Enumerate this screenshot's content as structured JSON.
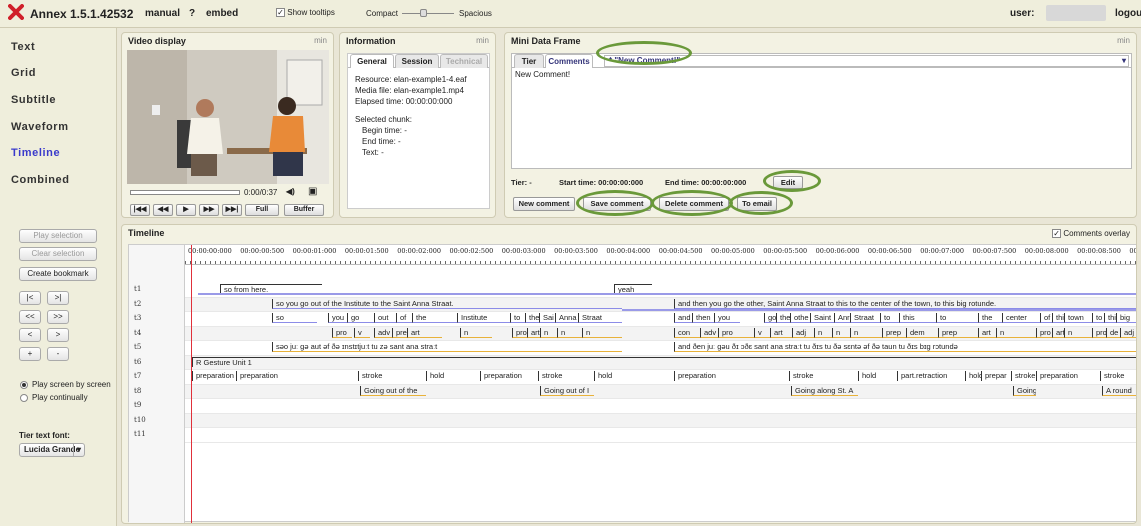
{
  "app": {
    "name": "Annex 1.5.1.42532",
    "manual": "manual",
    "help": "?",
    "embed": "embed",
    "tooltips": "Show tooltips",
    "compact": "Compact",
    "spacious": "Spacious",
    "user_label": "user:",
    "logout": "logout"
  },
  "nav": {
    "items": [
      "Text",
      "Grid",
      "Subtitle",
      "Waveform",
      "Timeline",
      "Combined"
    ],
    "active": "Timeline"
  },
  "side": {
    "play_selection": "Play selection",
    "clear_selection": "Clear selection",
    "create_bookmark": "Create bookmark",
    "b1": "|<",
    "b2": ">|",
    "b3": "<<",
    "b4": ">>",
    "b5": "<",
    "b6": ">",
    "b7": "+",
    "b8": "-",
    "radio1": "Play screen by screen",
    "radio2": "Play continually",
    "font_label": "Tier text font:",
    "font_value": "Lucida Grande"
  },
  "video": {
    "title": "Video display",
    "min": "min",
    "time": "0:00/0:37",
    "vol": "◀)",
    "fs": "▣",
    "btn1": "|◀◀",
    "btn2": "◀◀",
    "btn3": "▶",
    "btn4": "▶▶",
    "btn5": "▶▶|",
    "full": "Full",
    "buffer": "Buffer"
  },
  "info": {
    "title": "Information",
    "min": "min",
    "tabs": [
      "General",
      "Session",
      "Technical"
    ],
    "resource": "Resource:  elan-example1-4.eaf",
    "media": "Media file:  elan-example1.mp4",
    "elapsed": "Elapsed time:      00:00:00:000",
    "selected": "Selected chunk:",
    "begin": "Begin time:      -",
    "end": "End time:         -",
    "text": "Text:      -"
  },
  "mdf": {
    "title": "Mini Data Frame",
    "min": "min",
    "tab1": "Tier",
    "tab2": "Comments",
    "dropdown": "* \"New Comment!\"",
    "comment": "New Comment!",
    "tier": "Tier:   -",
    "start": "Start time:  00:00:00:000",
    "end": "End time:  00:00:00:000",
    "edit": "Edit",
    "new": "New comment",
    "save": "Save comment",
    "delete": "Delete comment",
    "email": "To email"
  },
  "timeline": {
    "title": "Timeline",
    "overlay": "Comments overlay",
    "ticks": [
      "00:00:00:000",
      "00:00:00:500",
      "00:00:01:000",
      "00:00:01:500",
      "00:00:02:000",
      "00:00:02:500",
      "00:00:03:000",
      "00:00:03:500",
      "00:00:04:000",
      "00:00:04:500",
      "00:00:05:000",
      "00:00:05:500",
      "00:00:06:000",
      "00:00:06:500",
      "00:00:07:000",
      "00:00:07:500",
      "00:00:08:000",
      "00:00:08:500",
      "00:00:0"
    ],
    "tiers": [
      "t1",
      "t2",
      "t3",
      "t4",
      "t5",
      "t6",
      "t7",
      "t8",
      "t9",
      "t10",
      "t11"
    ],
    "rows": [
      [
        [
          "so from here.",
          218,
          320
        ],
        [
          "yeah",
          612,
          650
        ]
      ],
      [
        [
          "so you go out of the Institute to the Saint Anna Straat.",
          270,
          620
        ],
        [
          "and then you go the other, Saint Anna Straat to this to the center of the town, to this big rotunde.",
          672,
          1135
        ]
      ],
      [
        [
          "so",
          270,
          315
        ],
        [
          "you",
          326,
          345
        ],
        [
          "go",
          345,
          372
        ],
        [
          "out",
          372,
          394
        ],
        [
          "of",
          394,
          410
        ],
        [
          "the",
          410,
          455
        ],
        [
          "Institute",
          455,
          508
        ],
        [
          "to",
          508,
          523
        ],
        [
          "the",
          523,
          537
        ],
        [
          "Sai",
          537,
          553
        ],
        [
          "Anna",
          553,
          576
        ],
        [
          "Straat",
          576,
          620
        ],
        [
          "and",
          672,
          690
        ],
        [
          "then",
          690,
          712
        ],
        [
          "you",
          712,
          738
        ],
        [
          "go",
          762,
          774
        ],
        [
          "the",
          774,
          788
        ],
        [
          "othe",
          788,
          808
        ],
        [
          "Saint",
          808,
          832
        ],
        [
          "Anr",
          832,
          848
        ],
        [
          "Straat",
          848,
          878
        ],
        [
          "to",
          878,
          897
        ],
        [
          "this",
          897,
          934
        ],
        [
          "to",
          934,
          976
        ],
        [
          "the",
          976,
          1000
        ],
        [
          "center",
          1000,
          1038
        ],
        [
          "of",
          1038,
          1050
        ],
        [
          "thi",
          1050,
          1062
        ],
        [
          "town",
          1062,
          1090
        ],
        [
          "to",
          1090,
          1102
        ],
        [
          "thi",
          1102,
          1114
        ],
        [
          "big",
          1114,
          1135
        ]
      ],
      [
        [
          "pro",
          330,
          350
        ],
        [
          "v",
          352,
          368
        ],
        [
          "adv",
          372,
          390
        ],
        [
          "prep",
          390,
          405
        ],
        [
          "art",
          405,
          440
        ],
        [
          "n",
          458,
          490
        ],
        [
          "pro",
          510,
          525
        ],
        [
          "art",
          525,
          538
        ],
        [
          "n",
          538,
          555
        ],
        [
          "n",
          555,
          580
        ],
        [
          "n",
          580,
          620
        ],
        [
          "con",
          672,
          698
        ],
        [
          "adv",
          698,
          716
        ],
        [
          "pro",
          716,
          752
        ],
        [
          "v",
          752,
          768
        ],
        [
          "art",
          768,
          790
        ],
        [
          "adj",
          790,
          812
        ],
        [
          "n",
          812,
          830
        ],
        [
          "n",
          830,
          848
        ],
        [
          "n",
          848,
          880
        ],
        [
          "prep",
          880,
          904
        ],
        [
          "dem",
          904,
          936
        ],
        [
          "prep",
          936,
          976
        ],
        [
          "art",
          976,
          994
        ],
        [
          "n",
          994,
          1034
        ],
        [
          "pro",
          1034,
          1050
        ],
        [
          "art",
          1050,
          1062
        ],
        [
          "n",
          1062,
          1090
        ],
        [
          "pro",
          1090,
          1104
        ],
        [
          "de",
          1104,
          1118
        ],
        [
          "adj",
          1118,
          1135
        ]
      ],
      [
        [
          "səo juː ɡə aut əf ðə ɪnstɪtjuːt tu zə sant ana straːt",
          270,
          620
        ],
        [
          "and ðen juː ɡəu ðɪ ɔðɛ sant ana straːt tu ðɪs tu ðə sɛntə əf ðə taun tu ðɪs bɪɡ rɔtundə",
          672,
          1135
        ]
      ],
      [
        [
          "R Gesture Unit 1",
          190,
          1135
        ]
      ],
      [
        [
          "preparation",
          190,
          234
        ],
        [
          "preparation",
          234,
          356
        ],
        [
          "stroke",
          356,
          424
        ],
        [
          "hold",
          424,
          478
        ],
        [
          "preparation",
          478,
          536
        ],
        [
          "stroke",
          536,
          592
        ],
        [
          "hold",
          592,
          672
        ],
        [
          "preparation",
          672,
          787
        ],
        [
          "stroke",
          787,
          856
        ],
        [
          "hold",
          856,
          895
        ],
        [
          "part.retraction",
          895,
          963
        ],
        [
          "hold",
          963,
          979
        ],
        [
          "prepar",
          979,
          1009
        ],
        [
          "stroke",
          1009,
          1034
        ],
        [
          "preparation",
          1034,
          1098
        ],
        [
          "stroke",
          1098,
          1135
        ]
      ],
      [
        [
          "Going out of the",
          358,
          424
        ],
        [
          "Going out of I",
          538,
          592
        ],
        [
          "Going along St. A",
          789,
          856
        ],
        [
          "Going",
          1011,
          1034
        ],
        [
          "A round",
          1100,
          1135
        ]
      ],
      [],
      [],
      []
    ]
  },
  "colors": {
    "accent": "#6a993a",
    "active_nav": "#3a3acb",
    "playhead": "#e0303a",
    "logo": "#d0202a"
  }
}
